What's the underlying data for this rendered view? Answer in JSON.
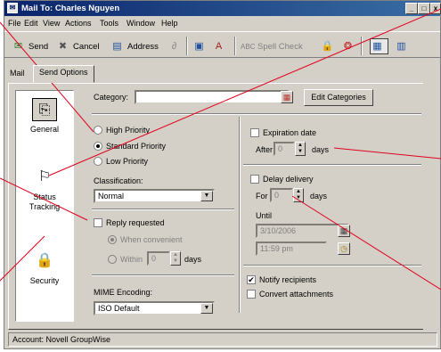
{
  "window": {
    "title": "Mail To: Charles Nguyen",
    "controls": [
      "_",
      "□",
      "x"
    ]
  },
  "menu": [
    "File",
    "Edit",
    "View",
    "Actions",
    "Tools",
    "Window",
    "Help"
  ],
  "toolbar": {
    "send": "Send",
    "cancel": "Cancel",
    "address": "Address",
    "spell_check": "Spell Check"
  },
  "tabs": [
    "Mail",
    "Send Options"
  ],
  "nav": {
    "general": "General",
    "status_tracking": "Status Tracking",
    "security": "Security"
  },
  "category": {
    "label": "Category:",
    "value": "",
    "edit_button": "Edit Categories"
  },
  "priority": {
    "options": [
      "High Priority",
      "Standard Priority",
      "Low Priority"
    ],
    "selected": "Standard Priority"
  },
  "classification": {
    "label": "Classification:",
    "value": "Normal"
  },
  "reply": {
    "label": "Reply requested",
    "checked": false,
    "when_convenient": "When convenient",
    "within": "Within",
    "within_value": "0",
    "days": "days"
  },
  "mime": {
    "label": "MIME Encoding:",
    "value": "ISO Default"
  },
  "expiration": {
    "label": "Expiration date",
    "checked": false,
    "after": "After",
    "after_value": "0",
    "days": "days"
  },
  "delay": {
    "label": "Delay delivery",
    "checked": false,
    "for": "For",
    "for_value": "0",
    "days": "days",
    "until": "Until",
    "until_date": "3/10/2006",
    "until_time": "11:59 pm"
  },
  "notify": {
    "label": "Notify recipients",
    "checked": true
  },
  "convert": {
    "label": "Convert attachments",
    "checked": false
  },
  "status": "Account: Novell GroupWise",
  "colors": {
    "title_start": "#0a246a",
    "title_end": "#3a6ea5",
    "callout_line": "#e2001a"
  }
}
